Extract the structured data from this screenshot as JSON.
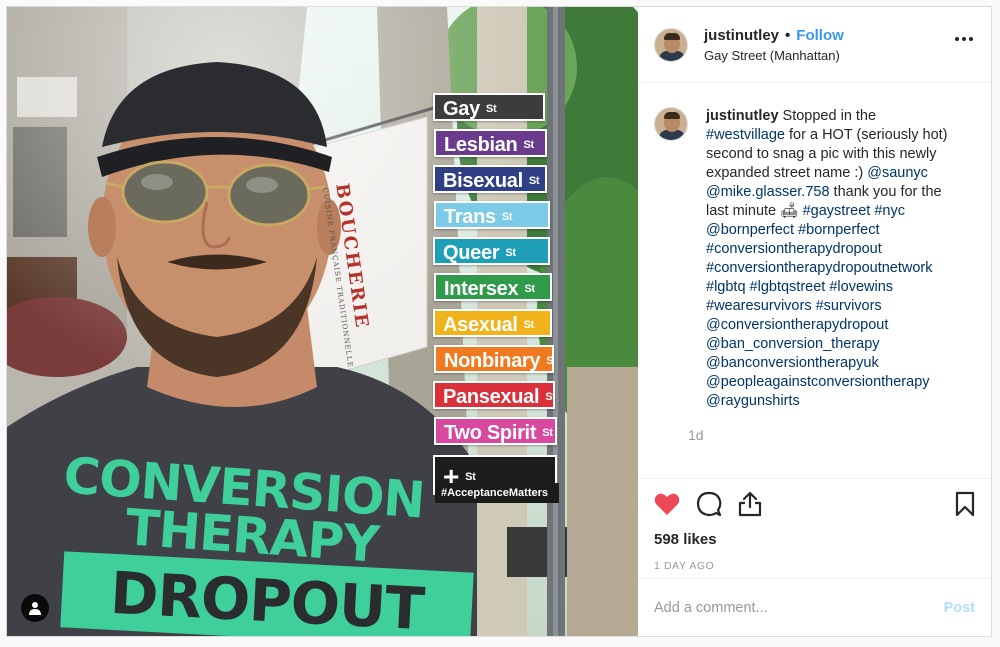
{
  "photo": {
    "street_signs": [
      {
        "name": "Gay",
        "suffix": "St",
        "color": "#3d3b3b"
      },
      {
        "name": "Lesbian",
        "suffix": "St",
        "color": "#6a3b8c"
      },
      {
        "name": "Bisexual",
        "suffix": "St",
        "color": "#2f3f86"
      },
      {
        "name": "Trans",
        "suffix": "St",
        "color": "#7ccbe6"
      },
      {
        "name": "Queer",
        "suffix": "St",
        "color": "#1f9fb7"
      },
      {
        "name": "Intersex",
        "suffix": "St",
        "color": "#2e9a4a"
      },
      {
        "name": "Asexual",
        "suffix": "St",
        "color": "#f0b31c"
      },
      {
        "name": "Nonbinary",
        "suffix": "St",
        "color": "#ef7a1f"
      },
      {
        "name": "Pansexual",
        "suffix": "St",
        "color": "#d9303a"
      },
      {
        "name": "Two Spirit",
        "suffix": "St",
        "color": "#d9489f"
      },
      {
        "name": "+",
        "suffix": "St",
        "color": "#1d1d1d"
      }
    ],
    "acceptance_sign": "#AcceptanceMatters",
    "banner_word": "BOUCHERIE",
    "banner_sub": "CUISINE FRANÇAISE TRADITIONNELLE",
    "shirt_lines": [
      "CONVERSION",
      "THERAPY",
      "DROPOUT"
    ],
    "user_tag_icon": "person-icon"
  },
  "header": {
    "username": "justinutley",
    "separator": "•",
    "follow_label": "Follow",
    "location": "Gay Street (Manhattan)",
    "more_icon": "more-options-icon"
  },
  "caption": {
    "username": "justinutley",
    "segments": [
      {
        "t": " Stopped in the ",
        "tag": false
      },
      {
        "t": "#westvillage",
        "tag": true
      },
      {
        "t": " for a HOT (seriously hot) second to snag a pic with this newly expanded street name :) ",
        "tag": false
      },
      {
        "t": "@saunyc",
        "tag": true
      },
      {
        "t": " ",
        "tag": false
      },
      {
        "t": "@mike.glasser.758",
        "tag": true
      },
      {
        "t": " thank you for the last minute ",
        "tag": false
      },
      {
        "t": "🛋",
        "tag": false
      },
      {
        "t": " ",
        "tag": false
      },
      {
        "t": "#gaystreet",
        "tag": true
      },
      {
        "t": " ",
        "tag": false
      },
      {
        "t": "#nyc",
        "tag": true
      },
      {
        "t": " ",
        "tag": false
      },
      {
        "t": "@bornperfect",
        "tag": true
      },
      {
        "t": " ",
        "tag": false
      },
      {
        "t": "#bornperfect",
        "tag": true
      },
      {
        "t": " ",
        "tag": false
      },
      {
        "t": "#conversiontherapydropout",
        "tag": true
      },
      {
        "t": " ",
        "tag": false
      },
      {
        "t": "#conversiontherapydropoutnetwork",
        "tag": true
      },
      {
        "t": " ",
        "tag": false
      },
      {
        "t": "#lgbtq",
        "tag": true
      },
      {
        "t": " ",
        "tag": false
      },
      {
        "t": "#lgbtqstreet",
        "tag": true
      },
      {
        "t": " ",
        "tag": false
      },
      {
        "t": "#lovewins",
        "tag": true
      },
      {
        "t": " ",
        "tag": false
      },
      {
        "t": "#wearesurvivors",
        "tag": true
      },
      {
        "t": " ",
        "tag": false
      },
      {
        "t": "#survivors",
        "tag": true
      },
      {
        "t": " ",
        "tag": false
      },
      {
        "t": "@conversiontherapydropout",
        "tag": true
      },
      {
        "t": " ",
        "tag": false
      },
      {
        "t": "@ban_conversion_therapy",
        "tag": true
      },
      {
        "t": " ",
        "tag": false
      },
      {
        "t": "@banconversiontherapyuk",
        "tag": true
      },
      {
        "t": " ",
        "tag": false
      },
      {
        "t": "@peopleagainstconversiontherapy",
        "tag": true
      },
      {
        "t": " ",
        "tag": false
      },
      {
        "t": "@raygunshirts",
        "tag": true
      }
    ],
    "time_ago": "1d"
  },
  "actions": {
    "icons": [
      "heart-icon",
      "comment-icon",
      "share-icon",
      "bookmark-icon"
    ],
    "likes": "598 likes",
    "date": "1 DAY AGO"
  },
  "comment_box": {
    "placeholder": "Add a comment...",
    "post_label": "Post"
  },
  "colors": {
    "link": "#3897f0",
    "hashtag": "#003569",
    "heart": "#ed4956",
    "post_disabled": "#b2dffc",
    "shirt_text": "#3ecf9a"
  }
}
